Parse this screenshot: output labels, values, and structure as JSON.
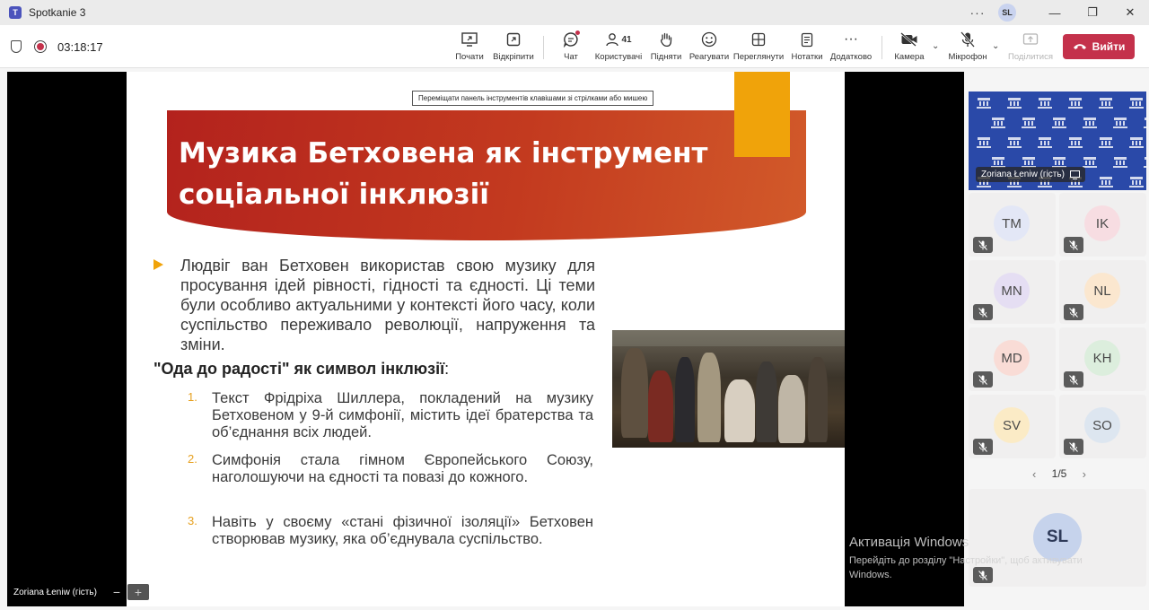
{
  "window": {
    "title": "Spotkanie 3",
    "user_initials": "SL"
  },
  "call": {
    "timer": "03:18:17"
  },
  "toolbar": {
    "start": "Почати",
    "detach": "Відкріпити",
    "chat": "Чат",
    "people": "Користувачі",
    "people_count": "41",
    "raise": "Підняти",
    "react": "Реагувати",
    "view": "Переглянути",
    "notes": "Нотатки",
    "more": "Додатково",
    "camera": "Камера",
    "mic": "Мікрофон",
    "share": "Поділитися",
    "leave": "Вийти"
  },
  "slide": {
    "hint": "Переміщати панель інструментів клавішами зі стрілками або мишею",
    "title_line1": "Музика Бетховена як інструмент",
    "title_line2": "соціальної інклюзії",
    "bullet": "Людвіг ван Бетховен використав свою музику для просування ідей рівності, гідності та єдності. Ці теми були особливо актуальними у контексті його часу, коли суспільство переживало революції, напруження та зміни.",
    "subheading": "\"Ода до радості\" як символ інклюзії",
    "subheading_colon": ":",
    "items": [
      {
        "num": "1.",
        "text": "Текст Фрідріха Шиллера, покладений на музику Бетховеном у 9-й симфонії, містить ідеї братерства та об’єднання всіх людей."
      },
      {
        "num": "2.",
        "text": "Симфонія стала гімном Європейського Союзу, наголошуючи на єдності та повазі до кожного."
      },
      {
        "num": "3.",
        "text": "Навіть у своєму «стані фізичної ізоляції» Бетховен створював музику, яка об’єднувала суспільство."
      }
    ]
  },
  "presenter": {
    "name": "Zoriana Łeniw (гість)"
  },
  "participants": [
    {
      "initials": "TM",
      "color": "#e3e7f6"
    },
    {
      "initials": "IK",
      "color": "#f7dde2"
    },
    {
      "initials": "MN",
      "color": "#e5def3"
    },
    {
      "initials": "NL",
      "color": "#fbe7cf"
    },
    {
      "initials": "MD",
      "color": "#f9dcd6"
    },
    {
      "initials": "KH",
      "color": "#dceedd"
    },
    {
      "initials": "SV",
      "color": "#fbebc6"
    },
    {
      "initials": "SO",
      "color": "#dde6f0"
    }
  ],
  "pager": {
    "label": "1/5"
  },
  "self": {
    "initials": "SL"
  },
  "watermark": {
    "title": "Активація Windows",
    "line1": "Перейдіть до розділу \"Настройки\", щоб активувати",
    "line2": "Windows."
  }
}
